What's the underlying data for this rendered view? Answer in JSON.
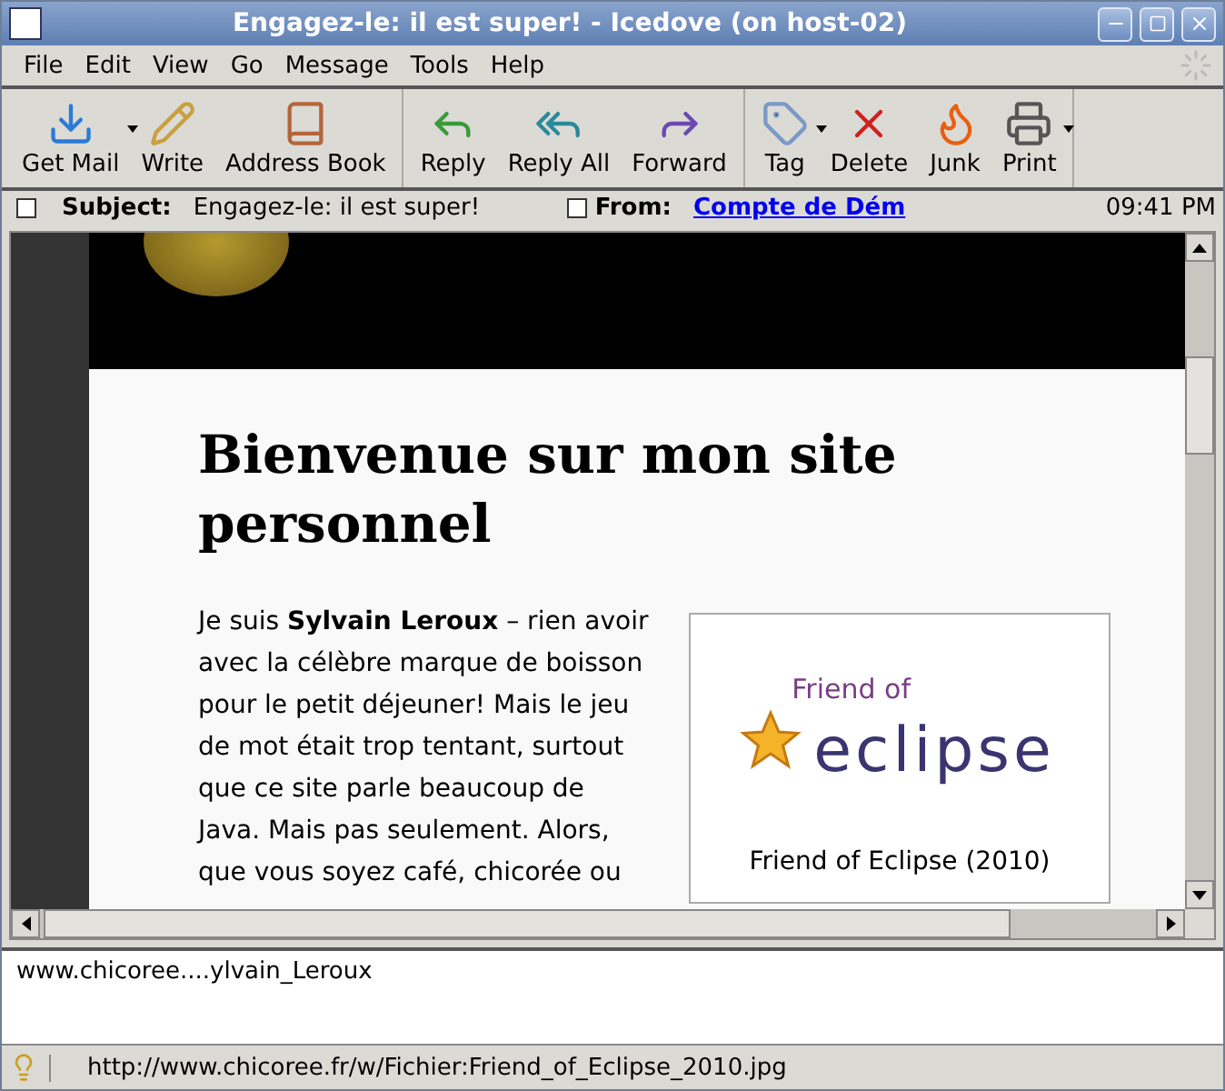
{
  "window": {
    "title": "Engagez-le: il est super! - Icedove (on host-02)"
  },
  "menu": [
    "File",
    "Edit",
    "View",
    "Go",
    "Message",
    "Tools",
    "Help"
  ],
  "toolbar": [
    [
      {
        "label": "Get Mail",
        "has_menu": true
      },
      {
        "label": "Write",
        "has_menu": false
      },
      {
        "label": "Address Book",
        "has_menu": false
      }
    ],
    [
      {
        "label": "Reply",
        "has_menu": false
      },
      {
        "label": "Reply All",
        "has_menu": false
      },
      {
        "label": "Forward",
        "has_menu": false
      }
    ],
    [
      {
        "label": "Tag",
        "has_menu": true
      },
      {
        "label": "Delete",
        "has_menu": false
      },
      {
        "label": "Junk",
        "has_menu": false
      },
      {
        "label": "Print",
        "has_menu": true
      }
    ]
  ],
  "header": {
    "subject_label": "Subject:",
    "subject": "Engagez-le: il est super!",
    "from_label": "From:",
    "from": "Compte de Dém",
    "time": "09:41 PM"
  },
  "page": {
    "heading": "Bienvenue sur mon site personnel",
    "paragraph": "Je suis **Sylvain Leroux** – rien avoir avec la célèbre marque de boisson pour le petit déjeuner! Mais le jeu de mot était trop tentant, surtout que ce site parle beaucoup de Java. Mais pas seulement. Alors, que vous soyez café, chicorée ou",
    "figure": {
      "logo_top": "Friend of",
      "logo_main": "eclipse",
      "caption": "Friend of Eclipse (2010)"
    }
  },
  "link_pane": {
    "text": "www.chicoree....ylvain_Leroux"
  },
  "status_bar": {
    "text": "http://www.chicoree.fr/w/Fichier:Friend_of_Eclipse_2010.jpg"
  }
}
